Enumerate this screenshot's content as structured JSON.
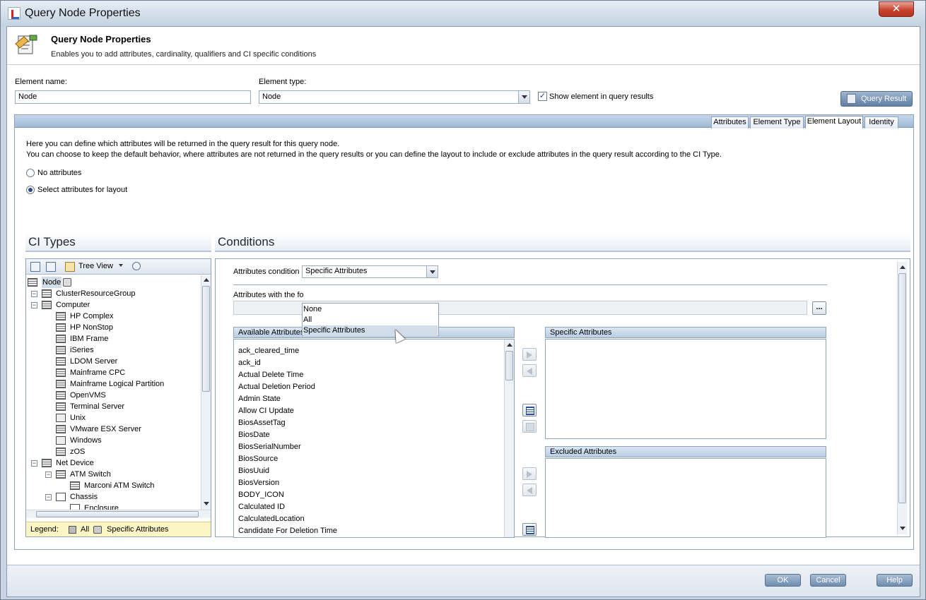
{
  "window": {
    "title": "Query Node Properties",
    "close_label": "✕"
  },
  "header": {
    "title": "Query Node Properties",
    "subtitle": "Enables you to add attributes, cardinality, qualifiers and CI specific conditions"
  },
  "form": {
    "element_name_label": "Element name:",
    "element_name_value": "Node",
    "element_type_label": "Element type:",
    "element_type_value": "Node",
    "show_in_results_label": "Show element in query results",
    "show_in_results_checked": "✓",
    "query_result_button": "Query Result"
  },
  "tabs": [
    {
      "label": "Attributes"
    },
    {
      "label": "Element Type"
    },
    {
      "label": "Element Layout"
    },
    {
      "label": "Identity"
    }
  ],
  "layout_tab": {
    "intro_line1": "Here you can define which attributes will be returned in the query result for this query node.",
    "intro_line2": "You can choose to keep the default behavior, where attributes are not returned in the query results or you can define the layout to include or exclude attributes in the query result according to the CI Type.",
    "radio_no_attributes": "No attributes",
    "radio_select_attributes": "Select attributes for layout"
  },
  "ci_types": {
    "heading": "CI Types",
    "tree_view_label": "Tree View",
    "nodes": [
      {
        "label": "Node"
      },
      {
        "label": "ClusterResourceGroup"
      },
      {
        "label": "Computer"
      },
      {
        "label": "HP Complex"
      },
      {
        "label": "HP NonStop"
      },
      {
        "label": "IBM Frame"
      },
      {
        "label": "iSeries"
      },
      {
        "label": "LDOM Server"
      },
      {
        "label": "Mainframe CPC"
      },
      {
        "label": "Mainframe Logical Partition"
      },
      {
        "label": "OpenVMS"
      },
      {
        "label": "Terminal Server"
      },
      {
        "label": "Unix"
      },
      {
        "label": "VMware ESX Server"
      },
      {
        "label": "Windows"
      },
      {
        "label": "zOS"
      },
      {
        "label": "Net Device"
      },
      {
        "label": "ATM Switch"
      },
      {
        "label": "Marconi ATM Switch"
      },
      {
        "label": "Chassis"
      },
      {
        "label": "Enclosure"
      }
    ],
    "legend_label": "Legend:",
    "legend_all": "All",
    "legend_specific": "Specific Attributes"
  },
  "conditions": {
    "heading": "Conditions",
    "attributes_condition_label": "Attributes condition",
    "attributes_condition_value": "Specific Attributes",
    "dropdown_options": [
      "None",
      "All",
      "Specific Attributes"
    ],
    "attributes_with_following_label": "Attributes with the fo",
    "ellipsis_button": "...",
    "available_header": "Available Attributes",
    "specific_header": "Specific Attributes",
    "excluded_header": "Excluded Attributes",
    "available": [
      "ack_cleared_time",
      "ack_id",
      "Actual Delete Time",
      "Actual Deletion Period",
      "Admin State",
      "Allow CI Update",
      "BiosAssetTag",
      "BiosDate",
      "BiosSerialNumber",
      "BiosSource",
      "BiosUuid",
      "BiosVersion",
      "BODY_ICON",
      "Calculated ID",
      "CalculatedLocation",
      "Candidate For Deletion Time"
    ]
  },
  "footer": {
    "ok": "OK",
    "cancel": "Cancel",
    "help": "Help"
  }
}
